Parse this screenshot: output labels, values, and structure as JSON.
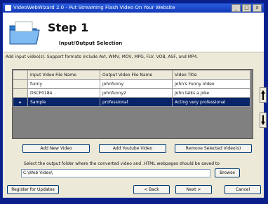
{
  "window": {
    "title": "VideoWebWizard 2.0 - Put Streaming Flash Video On Your Website",
    "close_label": "x",
    "max_label": "□",
    "min_label": "_"
  },
  "header": {
    "step_title": "Step 1",
    "subtitle": "Input/Output Selection"
  },
  "instructions": "Add input video(s). Support formats include AVI, WMV, MOV, MPG, FLV, VOB, ASF, and MP4.",
  "grid": {
    "columns": [
      "Input Video File Name",
      "Output Video File Name",
      "Video Title"
    ],
    "rows": [
      {
        "marker": "",
        "input": "funny",
        "output": "johnfunny",
        "title": "John's Funny Video"
      },
      {
        "marker": "",
        "input": "DSCF0184",
        "output": "johnfunny2",
        "title": "John talks a joke"
      },
      {
        "marker": "▸",
        "input": "Sample",
        "output": "professional",
        "title": "Acting very professional"
      }
    ],
    "selected_index": 2
  },
  "buttons": {
    "add_new": "Add New Video",
    "add_youtube": "Add Youtube Video",
    "remove": "Remove Selected Video(s)",
    "browse": "Browse",
    "register": "Register for Updates",
    "back": "< Back",
    "next": "Next >",
    "cancel": "Cancel"
  },
  "output": {
    "label": "Select the output folder where the converted video and .HTML webpages should be saved to",
    "folder_value": "C:\\Web Video\\"
  },
  "icons": {
    "move_up": "arrow-up-icon",
    "move_down": "arrow-down-icon",
    "header": "folder-icon"
  },
  "colors": {
    "selection": "#0a246a",
    "titlebar": "#1238b6"
  }
}
